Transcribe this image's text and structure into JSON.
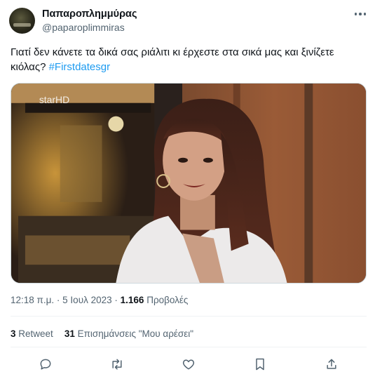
{
  "author": {
    "display_name": "Παπαροπλημμύρας",
    "handle": "@paparoplimmiras"
  },
  "tweet": {
    "text": "Γιατί δεν κάνετε τα δικά σας ριάλιτι κι έρχεστε στα σικά μας και ξινίζετε κιόλας?",
    "hashtag": "#Firstdatesgr"
  },
  "media": {
    "channel_logo": "starHD",
    "description_icon": "video-still"
  },
  "meta": {
    "time": "12:18 π.μ.",
    "separator": "·",
    "date": "5 Ιουλ 2023",
    "views_separator": "·",
    "views_count": "1.166",
    "views_label": "Προβολές"
  },
  "stats": {
    "retweets_count": "3",
    "retweets_label": "Retweet",
    "likes_count": "31",
    "likes_label": "Επισημάνσεις \"Μου αρέσει\""
  },
  "icons": {
    "more": "more-horizontal-icon",
    "reply": "reply-icon",
    "retweet": "retweet-icon",
    "like": "heart-icon",
    "bookmark": "bookmark-icon",
    "share": "share-icon"
  },
  "colors": {
    "text": "#0f1419",
    "secondary": "#536471",
    "link": "#1d9bf0",
    "border": "#eff3f4"
  }
}
